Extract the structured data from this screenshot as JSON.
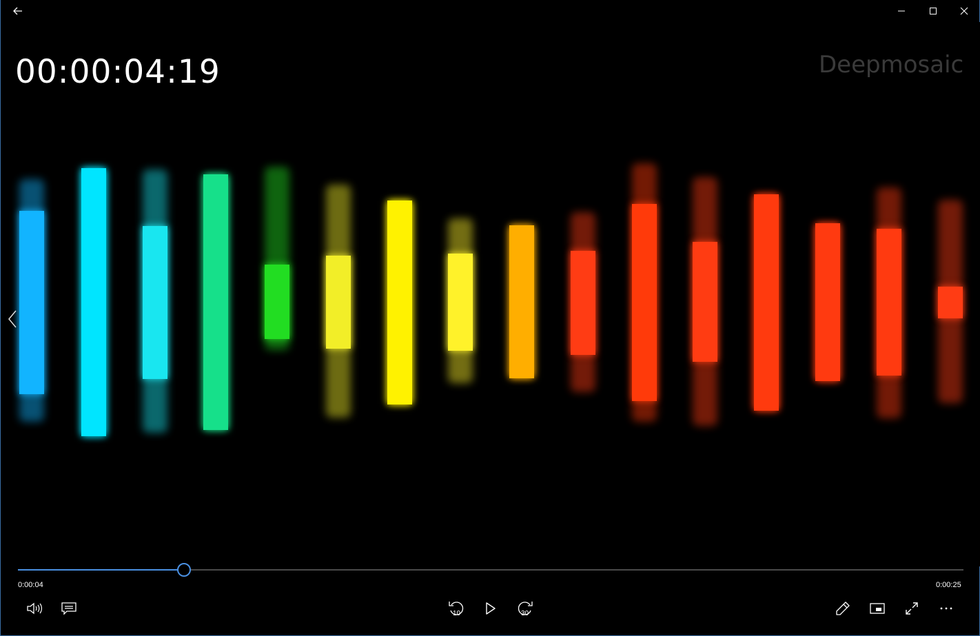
{
  "window": {
    "back_icon": "arrow-left-icon",
    "minimize_icon": "minimize-icon",
    "maximize_icon": "maximize-icon",
    "close_icon": "close-icon"
  },
  "video": {
    "timecode": "00:00:04:19",
    "watermark": "Deepmosaic",
    "prev_icon": "chevron-left-icon"
  },
  "playback": {
    "current_time": "0:00:04",
    "total_time": "0:00:25",
    "progress_fraction": 0.175,
    "accent_color": "#4a90e2"
  },
  "controls": {
    "volume_icon": "volume-icon",
    "captions_icon": "captions-icon",
    "skip_back_label": "10",
    "skip_back_icon": "skip-back-10-icon",
    "play_icon": "play-icon",
    "skip_forward_label": "30",
    "skip_forward_icon": "skip-forward-30-icon",
    "edit_icon": "pencil-icon",
    "miniview_icon": "mini-view-icon",
    "fullscreen_icon": "fullscreen-icon",
    "more_icon": "more-icon"
  },
  "visualizer_colors": [
    "#12b4ff",
    "#00e5ff",
    "#19e6f0",
    "#16e08a",
    "#22dd22",
    "#f2ee28",
    "#fff200",
    "#fff22a",
    "#ffae00",
    "#ff3c14",
    "#ff3a0a",
    "#ff3c12",
    "#ff3a0e",
    "#ff3a10",
    "#ff3a10",
    "#ff3c14"
  ]
}
